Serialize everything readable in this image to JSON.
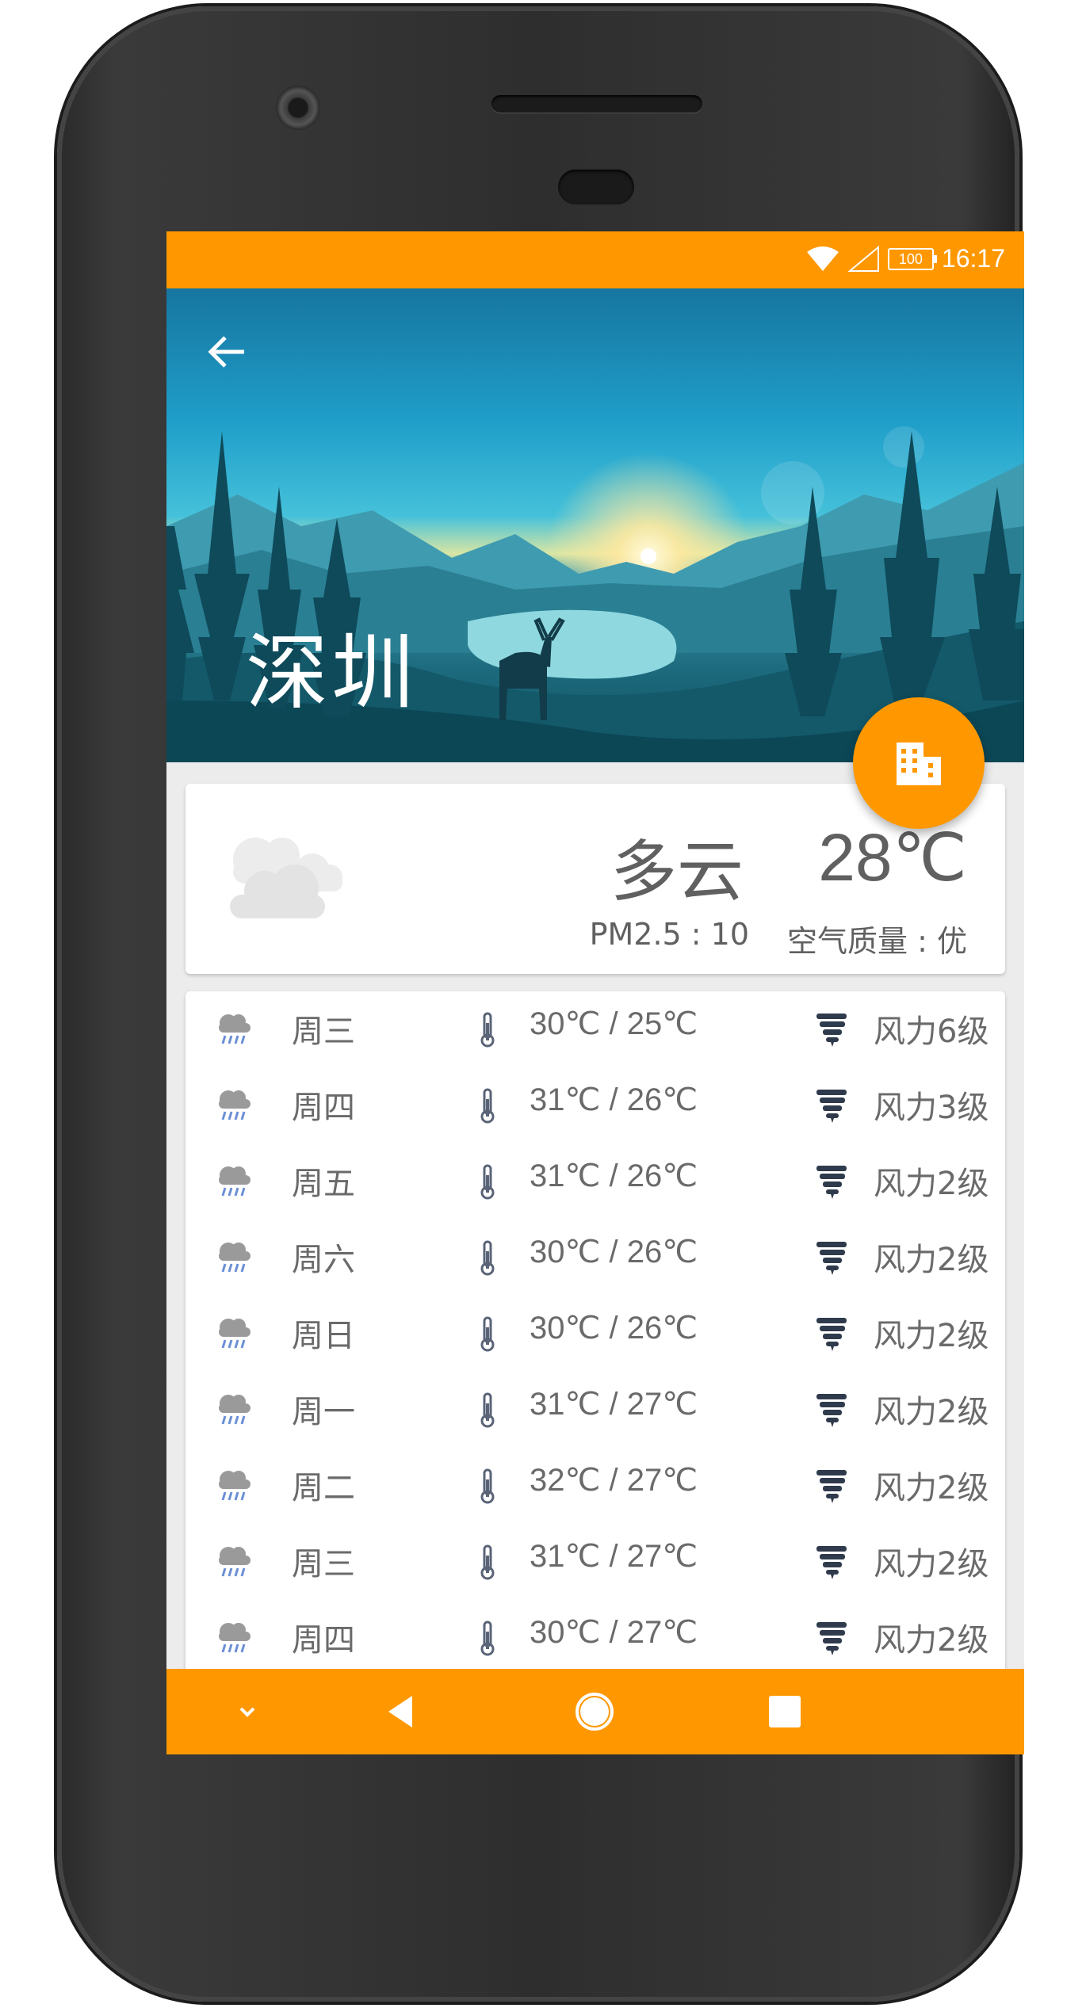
{
  "status_bar": {
    "battery": "100",
    "time": "16:17"
  },
  "header": {
    "city": "深圳"
  },
  "current": {
    "condition": "多云",
    "temperature": "28℃",
    "pm25": "PM2.5 : 10",
    "air_quality": "空气质量 : 优"
  },
  "forecast": [
    {
      "day": "周三",
      "range": "30℃ / 25℃",
      "wind": "风力6级"
    },
    {
      "day": "周四",
      "range": "31℃ / 26℃",
      "wind": "风力3级"
    },
    {
      "day": "周五",
      "range": "31℃ / 26℃",
      "wind": "风力2级"
    },
    {
      "day": "周六",
      "range": "30℃ / 26℃",
      "wind": "风力2级"
    },
    {
      "day": "周日",
      "range": "30℃ / 26℃",
      "wind": "风力2级"
    },
    {
      "day": "周一",
      "range": "31℃ / 27℃",
      "wind": "风力2级"
    },
    {
      "day": "周二",
      "range": "32℃ / 27℃",
      "wind": "风力2级"
    },
    {
      "day": "周三",
      "range": "31℃ / 27℃",
      "wind": "风力2级"
    },
    {
      "day": "周四",
      "range": "30℃ / 27℃",
      "wind": "风力2级"
    }
  ],
  "icons": {
    "back": "arrow-back-icon",
    "fab": "building-icon",
    "current": "cloudy-icon",
    "rain": "rain-cloud-icon",
    "thermometer": "thermometer-icon",
    "wind": "tornado-icon",
    "nav": [
      "chevron-down-icon",
      "back-triangle-icon",
      "home-circle-icon",
      "recents-square-icon"
    ]
  },
  "colors": {
    "accent": "#ff9800",
    "text": "#6a6a6a",
    "rain_icon": "#6b8fd6",
    "wind_icon": "#2f3b4c"
  }
}
